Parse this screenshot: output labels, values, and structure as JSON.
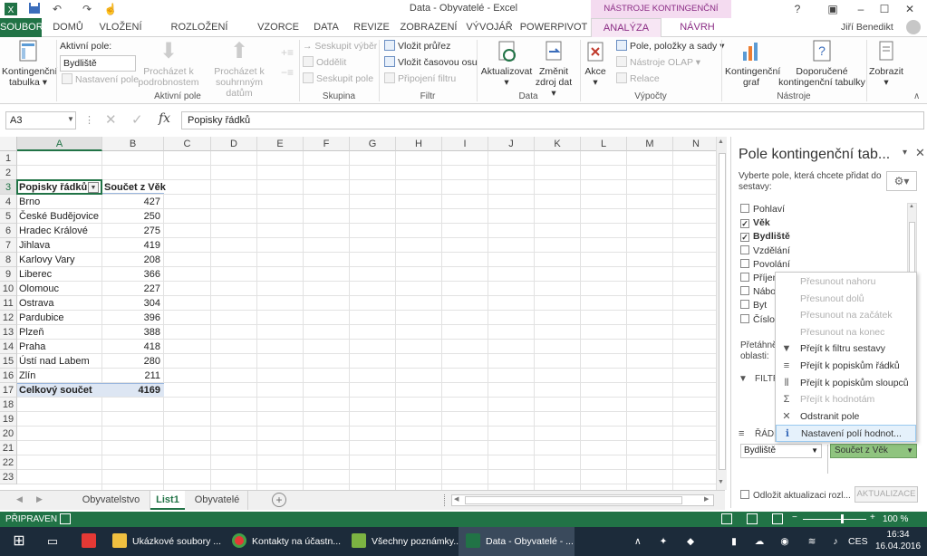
{
  "window": {
    "title": "Data - Obyvatelé - Excel",
    "user": "Jiří Benedikt",
    "context_header": "NÁSTROJE KONTINGENČNÍ TABULKY"
  },
  "tabs": {
    "file": "SOUBOR",
    "home": "DOMŮ",
    "insert": "VLOŽENÍ",
    "page_layout": "ROZLOŽENÍ STRÁNKY",
    "formulas": "VZORCE",
    "data": "DATA",
    "review": "REVIZE",
    "view": "ZOBRAZENÍ",
    "developer": "VÝVOJÁŘ",
    "powerpivot": "POWERPIVOT",
    "analyze": "ANALÝZA",
    "design": "NÁVRH"
  },
  "ribbon": {
    "pivot_table": "Kontingenční tabulka",
    "active_field_label": "Aktivní pole:",
    "active_field_value": "Bydliště",
    "field_settings": "Nastavení pole",
    "drill_down": "Procházet k podrobnostem",
    "drill_up": "Procházet k souhrnným datům",
    "group_active_field": "Aktivní pole",
    "group_selection": "Seskupit výběr",
    "ungroup": "Oddělit",
    "group_field": "Seskupit pole",
    "group_group": "Skupina",
    "insert_slicer": "Vložit průřez",
    "insert_timeline": "Vložit časovou osu",
    "filter_connections": "Připojení filtru",
    "group_filter": "Filtr",
    "refresh": "Aktualizovat",
    "change_source": "Změnit zdroj dat",
    "group_data": "Data",
    "actions": "Akce",
    "fields_items_sets": "Pole, položky a sady",
    "olap_tools": "Nástroje OLAP",
    "relationships": "Relace",
    "group_calculations": "Výpočty",
    "pivot_chart": "Kontingenční graf",
    "recommended": "Doporučené kontingenční tabulky",
    "group_tools": "Nástroje",
    "show": "Zobrazit"
  },
  "formula_bar": {
    "name_box": "A3",
    "fx": "fx",
    "content": "Popisky řádků"
  },
  "grid": {
    "columns": [
      "A",
      "B",
      "C",
      "D",
      "E",
      "F",
      "G",
      "H",
      "I",
      "J",
      "K",
      "L",
      "M",
      "N"
    ],
    "rows": [
      "1",
      "2",
      "3",
      "4",
      "5",
      "6",
      "7",
      "8",
      "9",
      "10",
      "11",
      "12",
      "13",
      "14",
      "15",
      "16",
      "17",
      "18",
      "19",
      "20",
      "21",
      "22",
      "23"
    ],
    "header_a": "Popisky řádků",
    "header_b": "Součet z Věk",
    "data": [
      {
        "city": "Brno",
        "value": "427"
      },
      {
        "city": "České Budějovice",
        "value": "250"
      },
      {
        "city": "Hradec Králové",
        "value": "275"
      },
      {
        "city": "Jihlava",
        "value": "419"
      },
      {
        "city": "Karlovy Vary",
        "value": "208"
      },
      {
        "city": "Liberec",
        "value": "366"
      },
      {
        "city": "Olomouc",
        "value": "227"
      },
      {
        "city": "Ostrava",
        "value": "304"
      },
      {
        "city": "Pardubice",
        "value": "396"
      },
      {
        "city": "Plzeň",
        "value": "388"
      },
      {
        "city": "Praha",
        "value": "418"
      },
      {
        "city": "Ústí nad Labem",
        "value": "280"
      },
      {
        "city": "Zlín",
        "value": "211"
      }
    ],
    "total_label": "Celkový součet",
    "total_value": "4169"
  },
  "sheets": {
    "tab1": "Obyvatelstvo",
    "tab2": "List1",
    "tab3": "Obyvatelé",
    "add": "+"
  },
  "status": {
    "ready": "PŘIPRAVEN",
    "zoom": "100 %"
  },
  "panel": {
    "title": "Pole kontingenční tab...",
    "instructions": "Vyberte pole, která chcete přidat do sestavy:",
    "fields": [
      {
        "label": "Pohlaví",
        "checked": false
      },
      {
        "label": "Věk",
        "checked": true
      },
      {
        "label": "Bydliště",
        "checked": true
      },
      {
        "label": "Vzdělání",
        "checked": false
      },
      {
        "label": "Povolání",
        "checked": false
      },
      {
        "label": "Příjem",
        "checked": false
      },
      {
        "label": "Nábož",
        "checked": false
      },
      {
        "label": "Byt",
        "checked": false
      },
      {
        "label": "Číslo",
        "checked": false
      }
    ],
    "drag_label": "Přetáhně",
    "drag_label2": "oblasti:",
    "filters": "FILTR",
    "rows": "ŘÁDK",
    "rows_item": "Bydliště",
    "values_item": "Součet z Věk",
    "defer_update": "Odložit aktualizaci rozl...",
    "update_button": "AKTUALIZACE"
  },
  "context_menu": {
    "items": [
      {
        "label": "Přesunout nahoru",
        "disabled": true,
        "icon": ""
      },
      {
        "label": "Přesunout dolů",
        "disabled": true,
        "icon": ""
      },
      {
        "label": "Přesunout na začátek",
        "disabled": true,
        "icon": ""
      },
      {
        "label": "Přesunout na konec",
        "disabled": true,
        "icon": ""
      },
      {
        "label": "Přejít k filtru sestavy",
        "disabled": false,
        "icon": "▼"
      },
      {
        "label": "Přejít k popiskům řádků",
        "disabled": false,
        "icon": "≡"
      },
      {
        "label": "Přejít k popiskům sloupců",
        "disabled": false,
        "icon": "⦀"
      },
      {
        "label": "Přejít k hodnotám",
        "disabled": true,
        "icon": "Σ"
      },
      {
        "label": "Odstranit pole",
        "disabled": false,
        "icon": "✕"
      },
      {
        "label": "Nastavení polí hodnot...",
        "disabled": false,
        "icon": "ℹ"
      }
    ]
  },
  "taskbar": {
    "explorer": "Ukázkové soubory ...",
    "chrome": "Kontakty na účastn...",
    "notes": "Všechny poznámky...",
    "excel": "Data - Obyvatelé - ...",
    "lang": "CES",
    "time": "16:34",
    "date": "16.04.2016"
  },
  "colors": {
    "excel_green": "#217346",
    "context_purple": "#8a2b84",
    "total_row_bg": "#dde6f3"
  }
}
